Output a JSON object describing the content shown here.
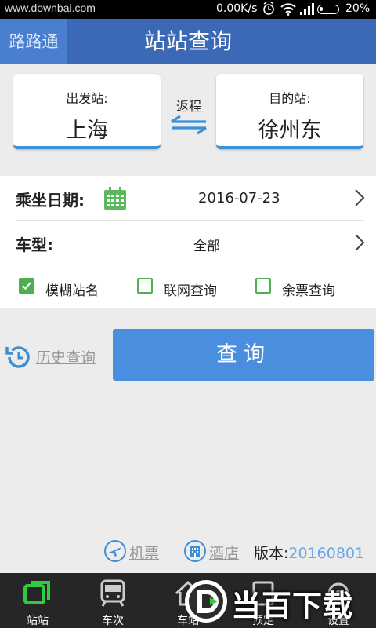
{
  "statusbar": {
    "watermark": "www.downbai.com",
    "speed": "0.00K/s",
    "battery_percent": "20%",
    "battery_level": 0.2
  },
  "header": {
    "brand": "路路通",
    "title": "站站查询"
  },
  "stations": {
    "from_label": "出发站:",
    "from_value": "上海",
    "return_label": "返程",
    "to_label": "目的站:",
    "to_value": "徐州东"
  },
  "date_row": {
    "label": "乘坐日期:",
    "value": "2016-07-23"
  },
  "type_row": {
    "label": "车型:",
    "value": "全部"
  },
  "options": [
    {
      "label": "模糊站名",
      "checked": true
    },
    {
      "label": "联网查询",
      "checked": false
    },
    {
      "label": "余票查询",
      "checked": false
    }
  ],
  "history_label": "历史查询",
  "query_button": "查询",
  "links": {
    "flight": "机票",
    "hotel": "酒店",
    "version_label": "版本:",
    "version_value": "20160801"
  },
  "tabs": [
    {
      "label": "站站",
      "icon": "station-icon",
      "active": true
    },
    {
      "label": "车次",
      "icon": "train-icon",
      "active": false
    },
    {
      "label": "车站",
      "icon": "home-icon",
      "active": false
    },
    {
      "label": "预定",
      "icon": "booking-icon",
      "active": false
    },
    {
      "label": "设置",
      "icon": "settings-icon",
      "active": false
    }
  ],
  "overlay_watermark": "当百下载",
  "colors": {
    "header": "#3b69b5",
    "accent_blue": "#4a8fdf",
    "check_green": "#4caf50",
    "tab_active": "#2ecc40"
  }
}
